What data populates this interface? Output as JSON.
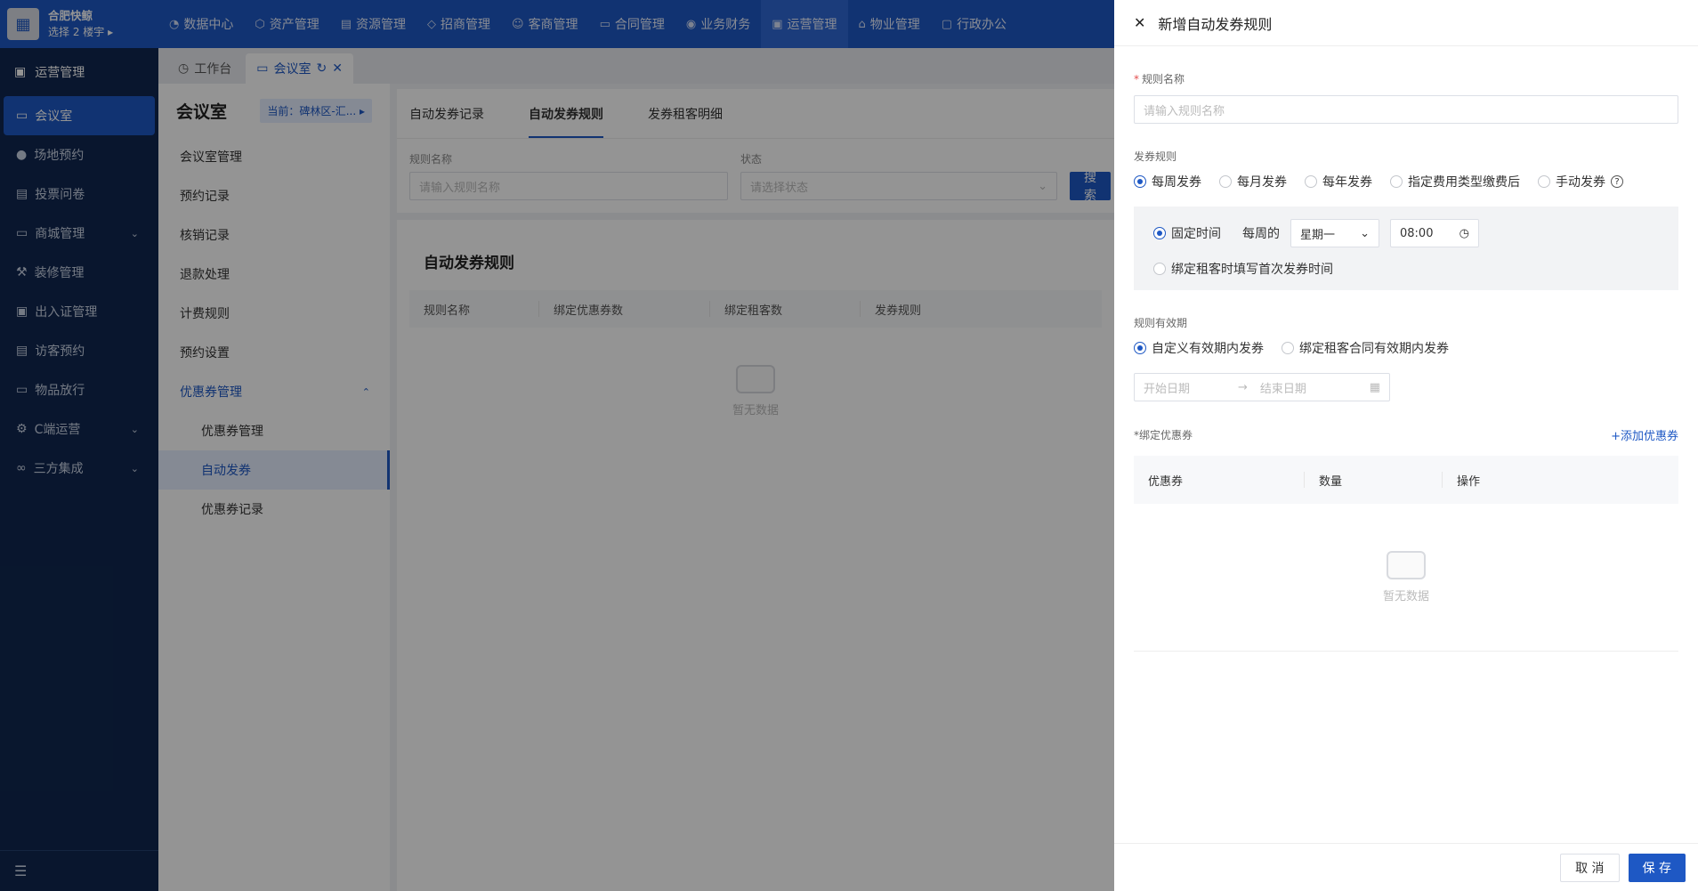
{
  "org": {
    "name": "合肥快鲸",
    "building": "选择 2 楼宇 ▸"
  },
  "nav": [
    {
      "label": "数据中心",
      "icon": "chart-icon",
      "glyph": "◔"
    },
    {
      "label": "资产管理",
      "icon": "cube-icon",
      "glyph": "⬡"
    },
    {
      "label": "资源管理",
      "icon": "document-icon",
      "glyph": "▤"
    },
    {
      "label": "招商管理",
      "icon": "tag-icon",
      "glyph": "◇"
    },
    {
      "label": "客商管理",
      "icon": "users-icon",
      "glyph": "☺"
    },
    {
      "label": "合同管理",
      "icon": "contract-icon",
      "glyph": "▭"
    },
    {
      "label": "业务财务",
      "icon": "coin-icon",
      "glyph": "◉"
    },
    {
      "label": "运营管理",
      "icon": "operations-icon",
      "glyph": "▣",
      "active": true
    },
    {
      "label": "物业管理",
      "icon": "home-icon",
      "glyph": "⌂"
    },
    {
      "label": "行政办公",
      "icon": "office-icon",
      "glyph": "▢"
    }
  ],
  "sidebar": {
    "title": "运营管理",
    "items": [
      {
        "label": "会议室",
        "icon": "monitor-icon",
        "glyph": "▭",
        "active": true
      },
      {
        "label": "场地预约",
        "icon": "person-icon",
        "glyph": "●"
      },
      {
        "label": "投票问卷",
        "icon": "survey-icon",
        "glyph": "▤"
      },
      {
        "label": "商城管理",
        "icon": "shop-icon",
        "glyph": "▭",
        "caret": "⌄"
      },
      {
        "label": "装修管理",
        "icon": "brush-icon",
        "glyph": "⚒"
      },
      {
        "label": "出入证管理",
        "icon": "pass-icon",
        "glyph": "▣"
      },
      {
        "label": "访客预约",
        "icon": "visitor-icon",
        "glyph": "▤"
      },
      {
        "label": "物品放行",
        "icon": "release-icon",
        "glyph": "▭"
      },
      {
        "label": "C端运营",
        "icon": "settings-icon",
        "glyph": "⚙",
        "caret": "⌄"
      },
      {
        "label": "三方集成",
        "icon": "integration-icon",
        "glyph": "∞",
        "caret": "⌄"
      }
    ]
  },
  "tabs": [
    {
      "label": "工作台",
      "icon": "dashboard-icon",
      "glyph": "◷"
    },
    {
      "label": "会议室",
      "icon": "monitor-icon",
      "glyph": "▭",
      "active": true
    }
  ],
  "submenu": {
    "title": "会议室",
    "current": "当前：碑林区-汇... ▸",
    "items": [
      {
        "label": "会议室管理"
      },
      {
        "label": "预约记录"
      },
      {
        "label": "核销记录"
      },
      {
        "label": "退款处理"
      },
      {
        "label": "计费规则"
      },
      {
        "label": "预约设置"
      },
      {
        "label": "优惠券管理",
        "group": true
      },
      {
        "label": "优惠券管理",
        "sub": true
      },
      {
        "label": "自动发券",
        "sub": true,
        "active": true
      },
      {
        "label": "优惠券记录",
        "sub": true
      }
    ]
  },
  "content": {
    "tabs": [
      {
        "label": "自动发券记录"
      },
      {
        "label": "自动发券规则",
        "active": true
      },
      {
        "label": "发券租客明细"
      }
    ],
    "filter": {
      "name_label": "规则名称",
      "name_placeholder": "请输入规则名称",
      "status_label": "状态",
      "status_placeholder": "请选择状态",
      "search_button": "搜 索"
    },
    "list_title": "自动发券规则",
    "columns": [
      "规则名称",
      "绑定优惠券数",
      "绑定租客数",
      "发券规则"
    ],
    "empty_text": "暂无数据"
  },
  "drawer": {
    "title": "新增自动发券规则",
    "rule_name_label": "规则名称",
    "rule_name_placeholder": "请输入规则名称",
    "issue_rule_label": "发券规则",
    "issue_options": [
      {
        "label": "每周发券",
        "checked": true
      },
      {
        "label": "每月发券"
      },
      {
        "label": "每年发券"
      },
      {
        "label": "指定费用类型缴费后"
      },
      {
        "label": "手动发券"
      }
    ],
    "fixed_time_label": "固定时间",
    "weekly_label": "每周的",
    "weekday_value": "星期一",
    "time_value": "08:00",
    "bind_time_label": "绑定租客时填写首次发券时间",
    "validity_label": "规则有效期",
    "validity_options": [
      {
        "label": "自定义有效期内发券",
        "checked": true
      },
      {
        "label": "绑定租客合同有效期内发券"
      }
    ],
    "start_date_placeholder": "开始日期",
    "end_date_placeholder": "结束日期",
    "bind_coupon_label": "*绑定优惠券",
    "add_coupon_link": "+添加优惠券",
    "coupon_columns": [
      "优惠券",
      "数量",
      "操作"
    ],
    "empty_text": "暂无数据",
    "cancel_button": "取 消",
    "save_button": "保 存"
  }
}
